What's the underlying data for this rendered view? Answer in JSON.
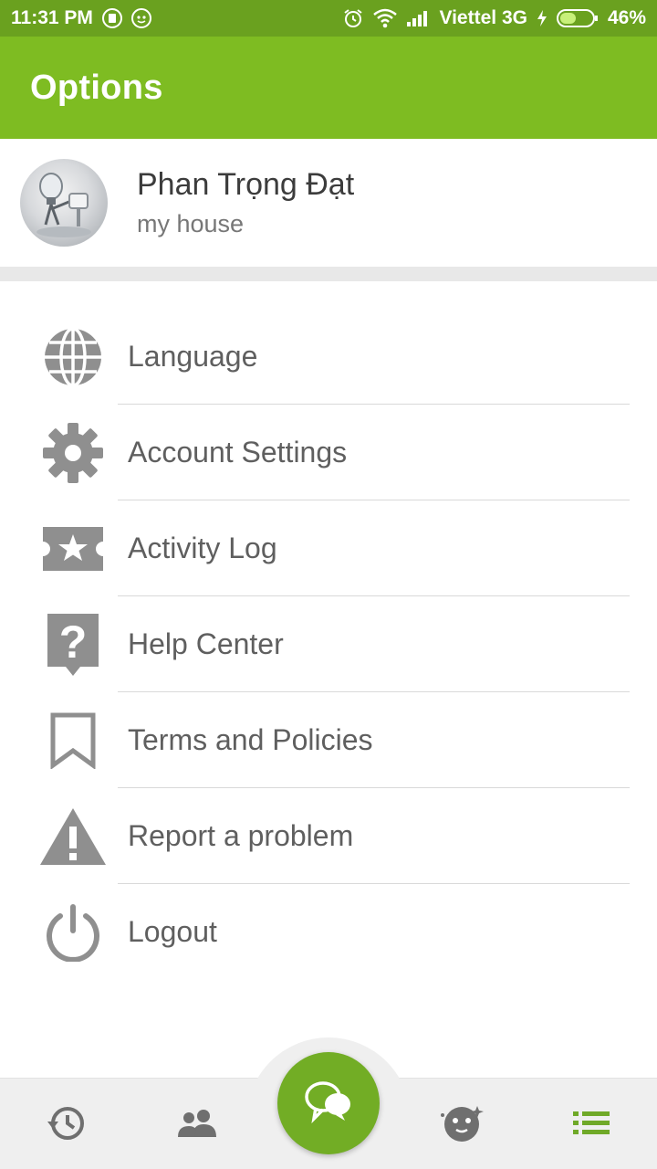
{
  "status_bar": {
    "time": "11:31 PM",
    "carrier": "Viettel 3G",
    "battery": "46%",
    "icons": [
      "android-notification-icon",
      "android-face-icon",
      "alarm-icon",
      "wifi-icon",
      "signal-icon",
      "charging-icon",
      "battery-icon"
    ]
  },
  "app_bar": {
    "title": "Options"
  },
  "profile": {
    "name": "Phan Trọng Đạt",
    "subtitle": "my house"
  },
  "menu": {
    "items": [
      {
        "label": "Language",
        "icon": "globe-icon"
      },
      {
        "label": "Account Settings",
        "icon": "gear-icon"
      },
      {
        "label": "Activity Log",
        "icon": "ticket-star-icon"
      },
      {
        "label": "Help Center",
        "icon": "help-bubble-icon"
      },
      {
        "label": "Terms and Policies",
        "icon": "bookmark-icon"
      },
      {
        "label": "Report a problem",
        "icon": "warning-icon"
      },
      {
        "label": "Logout",
        "icon": "power-icon"
      }
    ]
  },
  "bottom_nav": {
    "items": [
      "history-icon",
      "friends-icon",
      "chat-bubbles-icon",
      "mascot-face-icon",
      "list-menu-icon"
    ]
  },
  "colors": {
    "accent": "#7ebc22",
    "status": "#6aa11f",
    "icon_gray": "#8f8f8f"
  }
}
